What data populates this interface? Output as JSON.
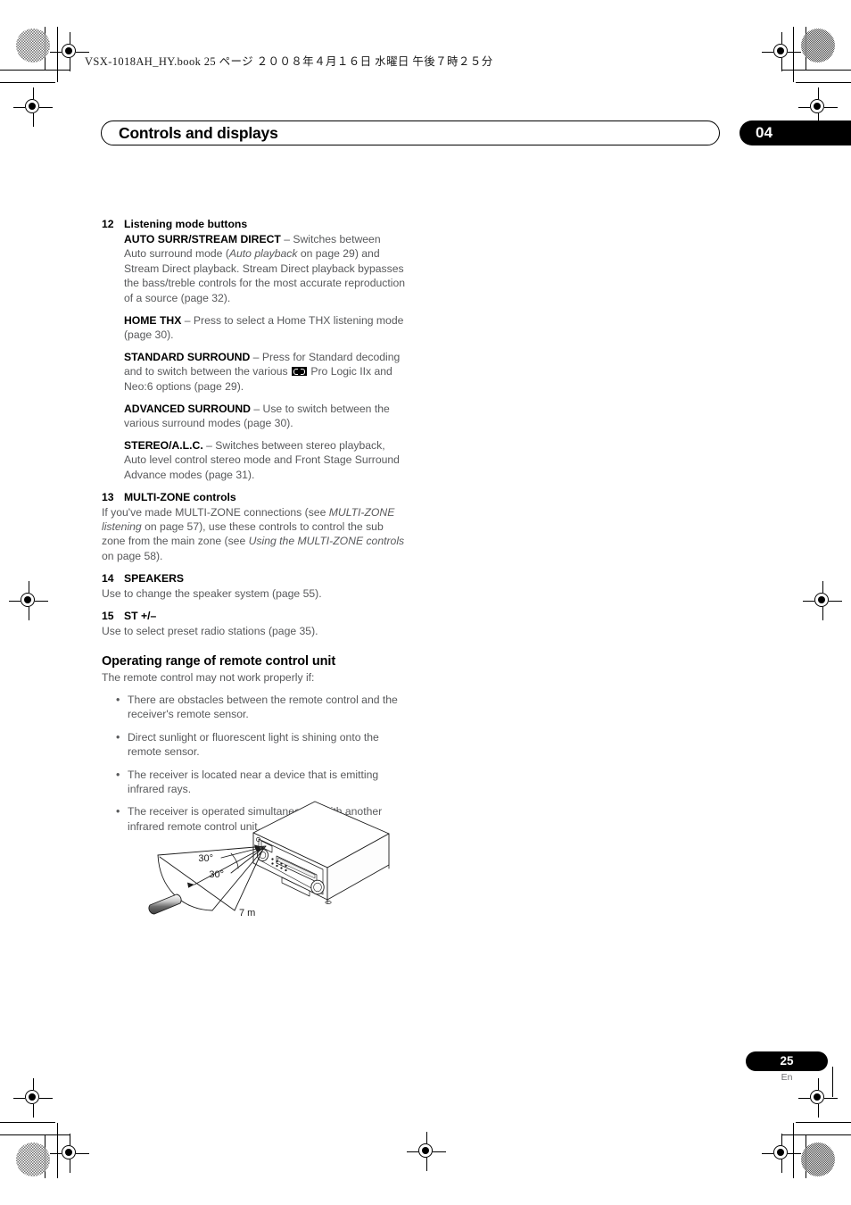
{
  "print_header": {
    "file_line": "VSX-1018AH_HY.book   25 ページ   ２００８年４月１６日   水曜日   午後７時２５分"
  },
  "chapter_header": {
    "title": "Controls and displays",
    "chapter_number": "04"
  },
  "content": {
    "items": [
      {
        "number": "12",
        "title": "Listening mode buttons",
        "paragraphs": [
          {
            "indent": true,
            "runs": [
              {
                "type": "bold",
                "text": "AUTO SURR/STREAM DIRECT"
              },
              {
                "type": "plain",
                "text": " – Switches between Auto surround mode ("
              },
              {
                "type": "italic",
                "text": "Auto playback"
              },
              {
                "type": "plain",
                "text": " on page 29) and Stream Direct playback. Stream Direct playback bypasses the bass/treble controls for the most accurate reproduction of a source (page 32)."
              }
            ]
          },
          {
            "indent": true,
            "runs": [
              {
                "type": "bold",
                "text": "HOME THX"
              },
              {
                "type": "plain",
                "text": " – Press to select a Home THX listening mode (page 30)."
              }
            ]
          },
          {
            "indent": true,
            "runs": [
              {
                "type": "bold",
                "text": "STANDARD SURROUND"
              },
              {
                "type": "plain",
                "text": " – Press for Standard decoding and to switch between the various "
              },
              {
                "type": "dolby-logo",
                "text": ""
              },
              {
                "type": "plain",
                "text": " Pro Logic IIx and Neo:6 options (page 29)."
              }
            ]
          },
          {
            "indent": true,
            "runs": [
              {
                "type": "bold",
                "text": "ADVANCED SURROUND"
              },
              {
                "type": "plain",
                "text": " – Use to switch between the various surround modes (page 30)."
              }
            ]
          },
          {
            "indent": true,
            "runs": [
              {
                "type": "bold",
                "text": "STEREO/A.L.C."
              },
              {
                "type": "plain",
                "text": " – Switches between stereo playback, Auto level control stereo mode and Front Stage Surround Advance modes (page 31)."
              }
            ]
          }
        ]
      },
      {
        "number": "13",
        "title": "MULTI-ZONE controls",
        "paragraphs": [
          {
            "indent": false,
            "runs": [
              {
                "type": "plain",
                "text": "If you've made MULTI-ZONE connections (see "
              },
              {
                "type": "italic",
                "text": "MULTI-ZONE listening"
              },
              {
                "type": "plain",
                "text": " on page 57), use these controls to control the sub zone from the main zone (see "
              },
              {
                "type": "italic",
                "text": "Using the MULTI-ZONE controls"
              },
              {
                "type": "plain",
                "text": " on page 58)."
              }
            ]
          }
        ]
      },
      {
        "number": "14",
        "title": "SPEAKERS",
        "paragraphs": [
          {
            "indent": false,
            "runs": [
              {
                "type": "plain",
                "text": "Use to change the speaker system (page 55)."
              }
            ]
          }
        ]
      },
      {
        "number": "15",
        "title": "ST +/–",
        "paragraphs": [
          {
            "indent": false,
            "runs": [
              {
                "type": "plain",
                "text": "Use to select preset radio stations (page 35)."
              }
            ]
          }
        ]
      }
    ],
    "section": {
      "heading": "Operating range of remote control unit",
      "intro": "The remote control may not work properly if:",
      "bullets": [
        "There are obstacles between the remote control and the receiver's remote sensor.",
        "Direct sunlight or fluorescent light is shining onto the remote sensor.",
        "The receiver is located near a device that is emitting infrared rays.",
        "The receiver is operated simultaneously with another infrared remote control unit."
      ]
    }
  },
  "figure": {
    "caption_labels": {
      "angle_upper": "30°",
      "angle_lower": "30°",
      "distance": "7 m"
    }
  },
  "footer": {
    "page_number": "25",
    "language": "En"
  }
}
